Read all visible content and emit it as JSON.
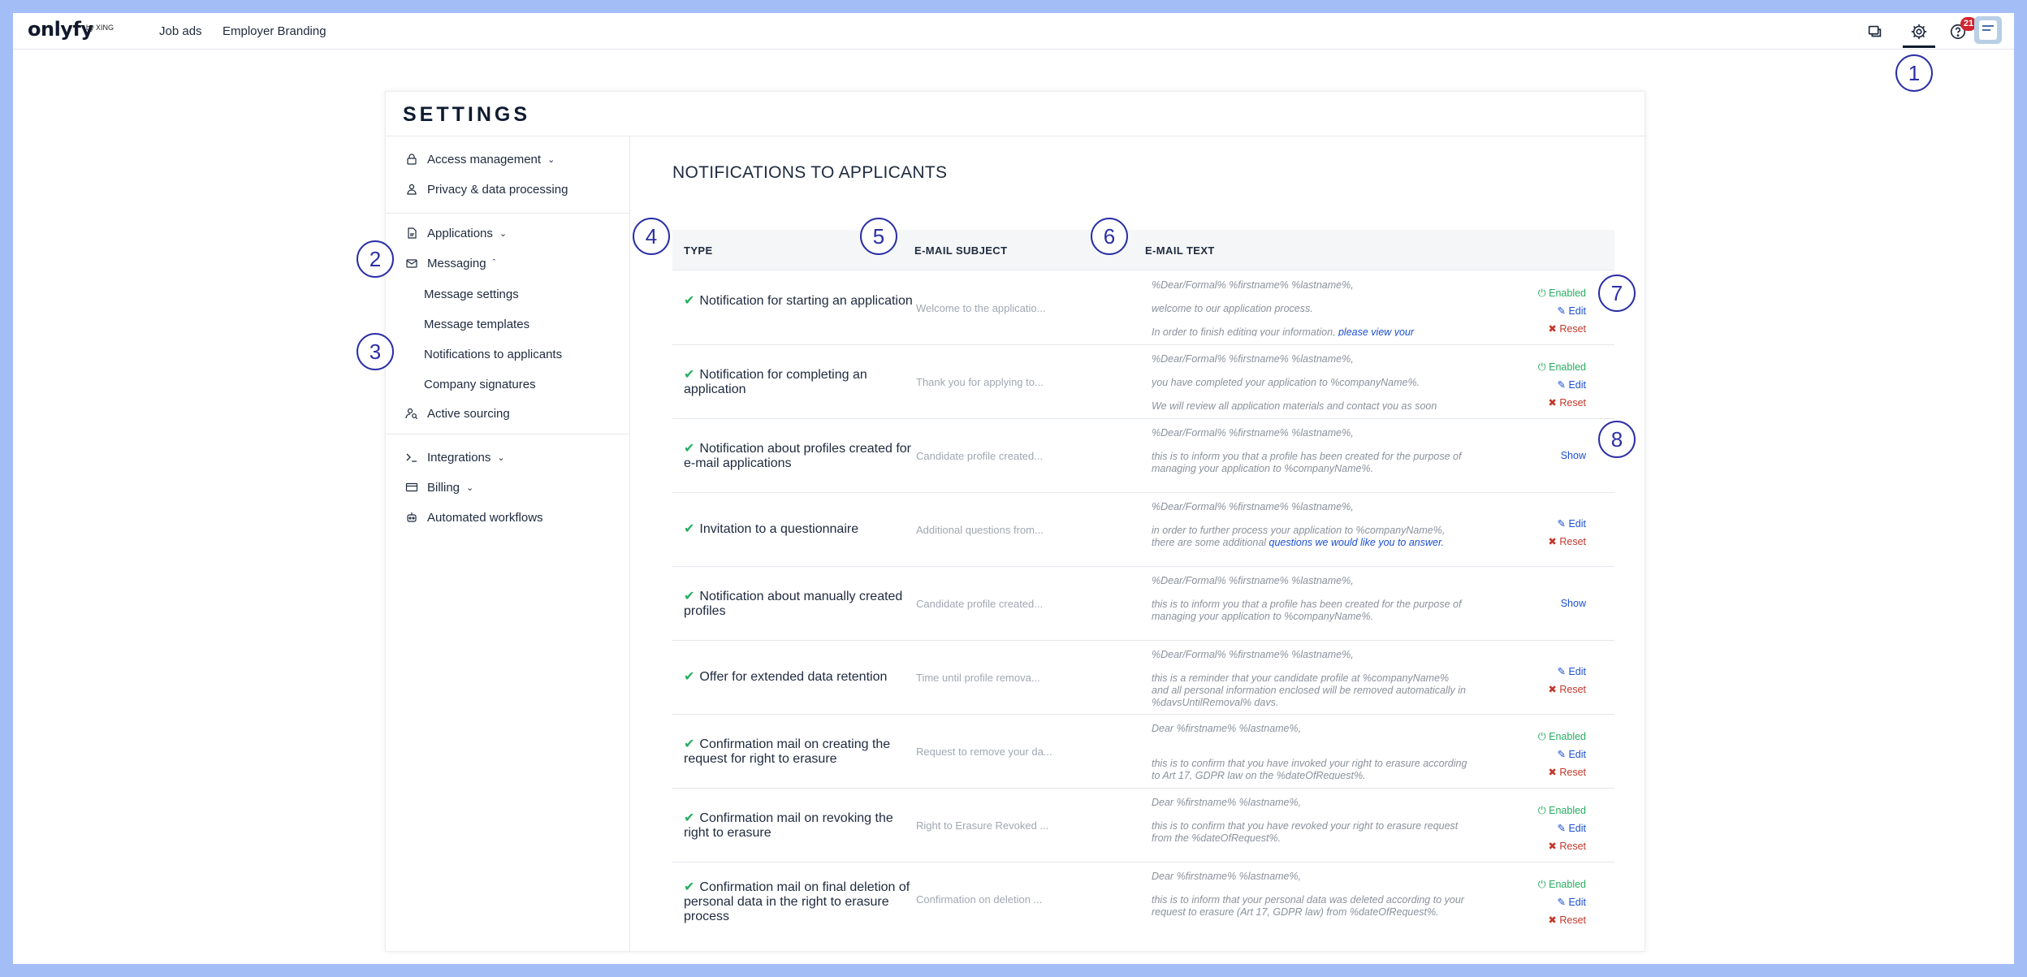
{
  "topbar": {
    "logo": "onlyfy",
    "logo_by": "by XING",
    "nav": [
      "Job ads",
      "Employer Branding"
    ],
    "notification_count": "21",
    "icons": [
      "chat-icon",
      "gear-icon",
      "help-icon"
    ]
  },
  "settings": {
    "title": "SETTINGS",
    "sidebar": {
      "access_management": "Access management",
      "privacy": "Privacy & data processing",
      "applications": "Applications",
      "messaging": "Messaging",
      "message_settings": "Message settings",
      "message_templates": "Message templates",
      "notifications_to_applicants": "Notifications to applicants",
      "company_signatures": "Company signatures",
      "active_sourcing": "Active sourcing",
      "integrations": "Integrations",
      "billing": "Billing",
      "automated_workflows": "Automated workflows"
    }
  },
  "main": {
    "section_title": "NOTIFICATIONS TO APPLICANTS",
    "columns": {
      "type": "TYPE",
      "subject": "E-MAIL SUBJECT",
      "text": "E-MAIL TEXT"
    },
    "actions": {
      "enabled": "Enabled",
      "edit": "Edit",
      "reset": "Reset",
      "show": "Show"
    },
    "rows": [
      {
        "type": "Notification for starting an application",
        "subject": "Welcome to the applicatio...",
        "line1": "%Dear/Formal% %firstname% %lastname%,",
        "line2": "welcome to our application process.",
        "line3": "In order to finish editing your information, ",
        "link": "please view your"
      },
      {
        "type": "Notification for completing an application",
        "subject": "Thank you for applying to...",
        "line1": "%Dear/Formal% %firstname% %lastname%,",
        "line2": "you have completed your application to %companyName%.",
        "line3": "We will review all application materials and contact you as soon"
      },
      {
        "type": "Notification about profiles created for e-mail applications",
        "subject": "Candidate profile created...",
        "line1": "%Dear/Formal% %firstname% %lastname%,",
        "line2": "this is to inform you that a profile has been created for the purpose of managing your application to %companyName%."
      },
      {
        "type": "Invitation to a questionnaire",
        "subject": "Additional questions from...",
        "line1": "%Dear/Formal% %firstname% %lastname%,",
        "line2": "in order to further process your application to %companyName%, there are some additional ",
        "link": "questions we would like you to answer."
      },
      {
        "type": "Notification about manually created profiles",
        "subject": "Candidate profile created...",
        "line1": "%Dear/Formal% %firstname% %lastname%,",
        "line2": "this is to inform you that a profile has been created for the purpose of managing your application to %companyName%."
      },
      {
        "type": "Offer for extended data retention",
        "subject": "Time until profile remova...",
        "line1": "%Dear/Formal% %firstname% %lastname%,",
        "line2": "this is a reminder that your candidate profile at %companyName% and all personal information enclosed will be removed automatically in %daysUntilRemoval% days."
      },
      {
        "type": "Confirmation mail on creating the request for right to erasure",
        "subject": "Request to remove your da...",
        "line1": "Dear %firstname% %lastname%,",
        "line2": "this is to confirm that you have invoked your right to erasure according to Art 17, GDPR law on the %dateOfRequest%."
      },
      {
        "type": "Confirmation mail on revoking the right to erasure",
        "subject": "Right to Erasure Revoked ...",
        "line1": "Dear %firstname% %lastname%,",
        "line2": "this is to confirm that you have revoked your right to erasure request from the %dateOfRequest%."
      },
      {
        "type": "Confirmation mail on final deletion of personal data in the right to erasure process",
        "subject": "Confirmation on deletion ...",
        "line1": "Dear %firstname% %lastname%,",
        "line2": "this is to inform that your personal data was deleted according to your request to erasure (Art 17, GDPR law) from %dateOfRequest%."
      }
    ]
  },
  "callouts": [
    "1",
    "2",
    "3",
    "4",
    "5",
    "6",
    "7",
    "8"
  ]
}
